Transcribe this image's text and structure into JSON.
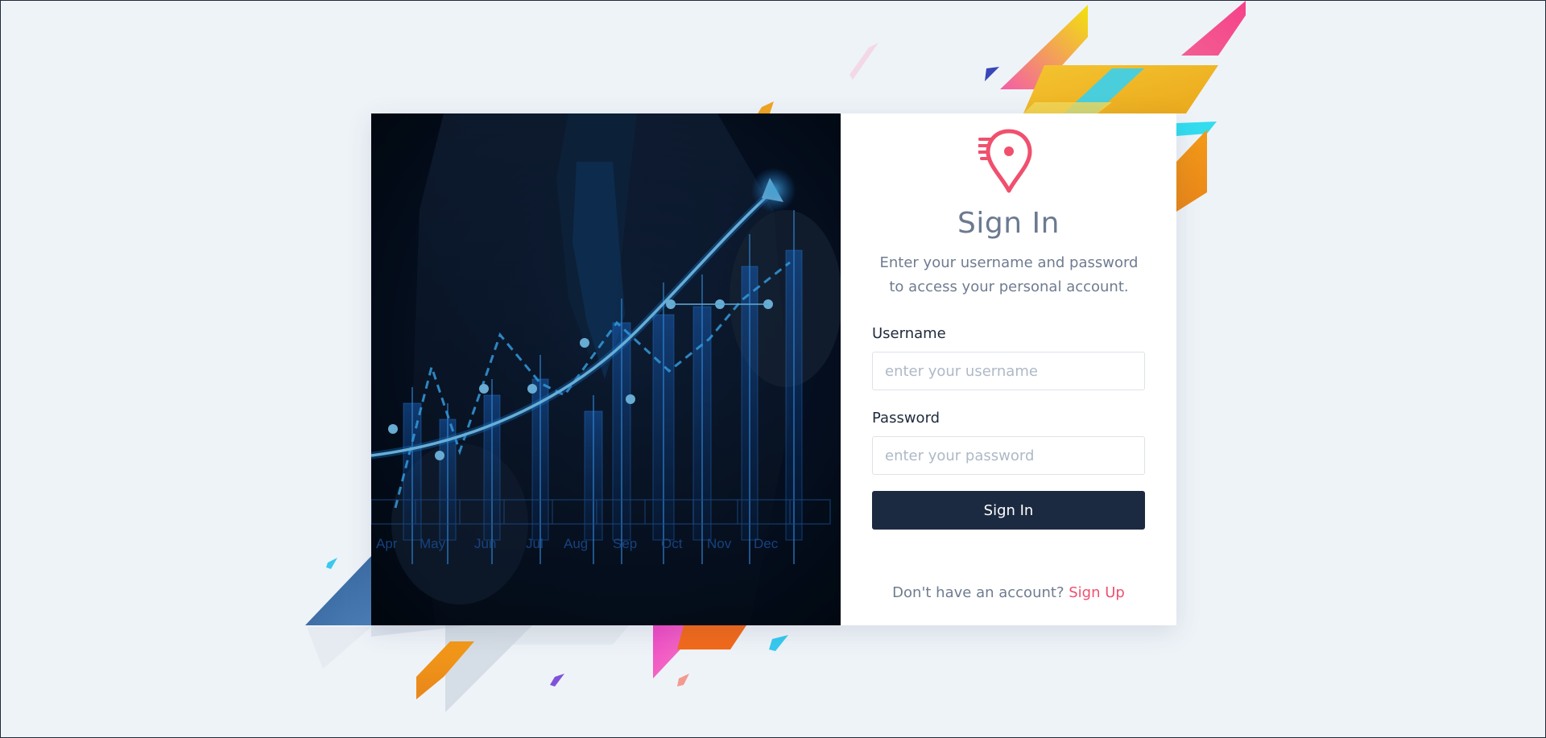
{
  "colors": {
    "background": "#eef3f8",
    "accent": "#f0506e",
    "button": "#1c2a41",
    "title": "#6c7a90"
  },
  "hero": {
    "icon": "business-growth-chart-image",
    "months": [
      "Apr",
      "May",
      "Jun",
      "Jul",
      "Aug",
      "Sep",
      "Oct",
      "Nov",
      "Dec"
    ]
  },
  "auth": {
    "logo_icon": "map-pin-logo-icon",
    "title": "Sign In",
    "subtitle": "Enter your username and password to access your personal account.",
    "username": {
      "label": "Username",
      "placeholder": "enter your username",
      "value": ""
    },
    "password": {
      "label": "Password",
      "placeholder": "enter your password",
      "value": ""
    },
    "submit_label": "Sign In",
    "signup_prompt": "Don't have an account?",
    "signup_link": "Sign Up"
  }
}
